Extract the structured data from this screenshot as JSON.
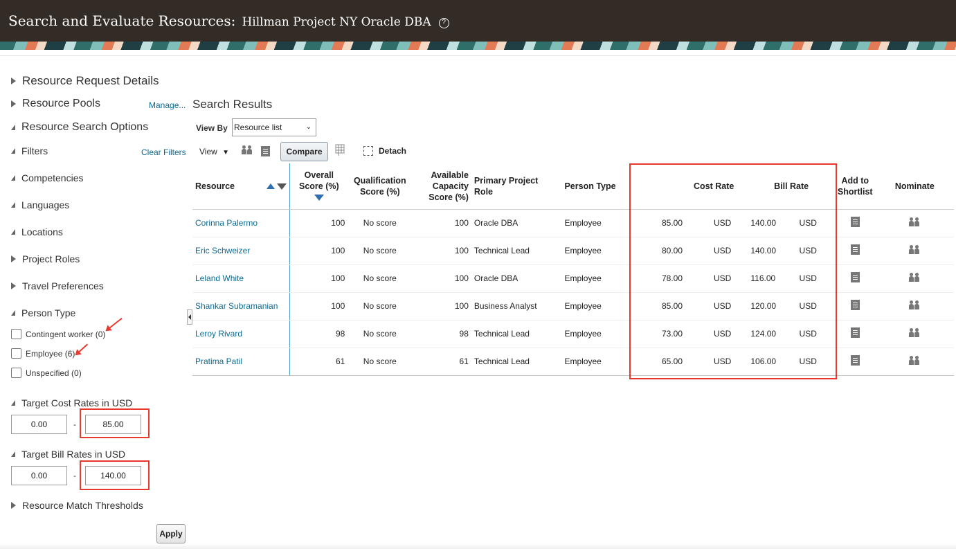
{
  "header": {
    "title": "Search and Evaluate Resources:",
    "project": "Hillman Project NY Oracle DBA",
    "help": "?"
  },
  "left": {
    "sections": {
      "resource_request_details": "Resource Request Details",
      "resource_pools": "Resource Pools",
      "manage_link": "Manage...",
      "resource_search_options": "Resource Search Options",
      "filters": "Filters",
      "clear_filters": "Clear Filters",
      "competencies": "Competencies",
      "languages": "Languages",
      "locations": "Locations",
      "project_roles": "Project Roles",
      "travel_preferences": "Travel Preferences",
      "person_type": "Person Type",
      "target_cost_rates": "Target Cost Rates in USD",
      "target_bill_rates": "Target Bill Rates in USD",
      "resource_match_thresholds": "Resource Match Thresholds"
    },
    "person_types": [
      {
        "label": "Contingent worker (0)"
      },
      {
        "label": "Employee (6)"
      },
      {
        "label": "Unspecified (0)"
      }
    ],
    "cost_rate": {
      "min": "0.00",
      "max": "85.00"
    },
    "bill_rate": {
      "min": "0.00",
      "max": "140.00"
    },
    "dash": "-",
    "apply": "Apply"
  },
  "results": {
    "title": "Search Results",
    "view_by_label": "View By",
    "view_by_value": "Resource list",
    "view_label": "View",
    "compare": "Compare",
    "detach": "Detach",
    "columns": {
      "resource": "Resource",
      "overall_score": "Overall Score (%)",
      "qualification_score": "Qualification Score (%)",
      "available_capacity": "Available Capacity Score (%)",
      "primary_project_role": "Primary Project Role",
      "person_type": "Person Type",
      "cost_rate": "Cost Rate",
      "bill_rate": "Bill Rate",
      "add_to_shortlist": "Add to Shortlist",
      "nominate": "Nominate"
    },
    "rows": [
      {
        "name": "Corinna Palermo",
        "overall": "100",
        "qual": "No score",
        "capacity": "100",
        "role": "Oracle DBA",
        "ptype": "Employee",
        "cost": "85.00",
        "cost_cur": "USD",
        "bill": "140.00",
        "bill_cur": "USD"
      },
      {
        "name": "Eric Schweizer",
        "overall": "100",
        "qual": "No score",
        "capacity": "100",
        "role": "Technical Lead",
        "ptype": "Employee",
        "cost": "80.00",
        "cost_cur": "USD",
        "bill": "140.00",
        "bill_cur": "USD"
      },
      {
        "name": "Leland White",
        "overall": "100",
        "qual": "No score",
        "capacity": "100",
        "role": "Oracle DBA",
        "ptype": "Employee",
        "cost": "78.00",
        "cost_cur": "USD",
        "bill": "116.00",
        "bill_cur": "USD"
      },
      {
        "name": "Shankar Subramanian",
        "overall": "100",
        "qual": "No score",
        "capacity": "100",
        "role": "Business Analyst",
        "ptype": "Employee",
        "cost": "85.00",
        "cost_cur": "USD",
        "bill": "120.00",
        "bill_cur": "USD"
      },
      {
        "name": "Leroy Rivard",
        "overall": "98",
        "qual": "No score",
        "capacity": "98",
        "role": "Technical Lead",
        "ptype": "Employee",
        "cost": "73.00",
        "cost_cur": "USD",
        "bill": "124.00",
        "bill_cur": "USD"
      },
      {
        "name": "Pratima Patil",
        "overall": "61",
        "qual": "No score",
        "capacity": "61",
        "role": "Technical Lead",
        "ptype": "Employee",
        "cost": "65.00",
        "cost_cur": "USD",
        "bill": "106.00",
        "bill_cur": "USD"
      }
    ]
  },
  "colors": {
    "header_bg": "#322b26",
    "link": "#0b6a92",
    "highlight_red": "#e8392e",
    "sort_blue": "#2f6fb0"
  }
}
